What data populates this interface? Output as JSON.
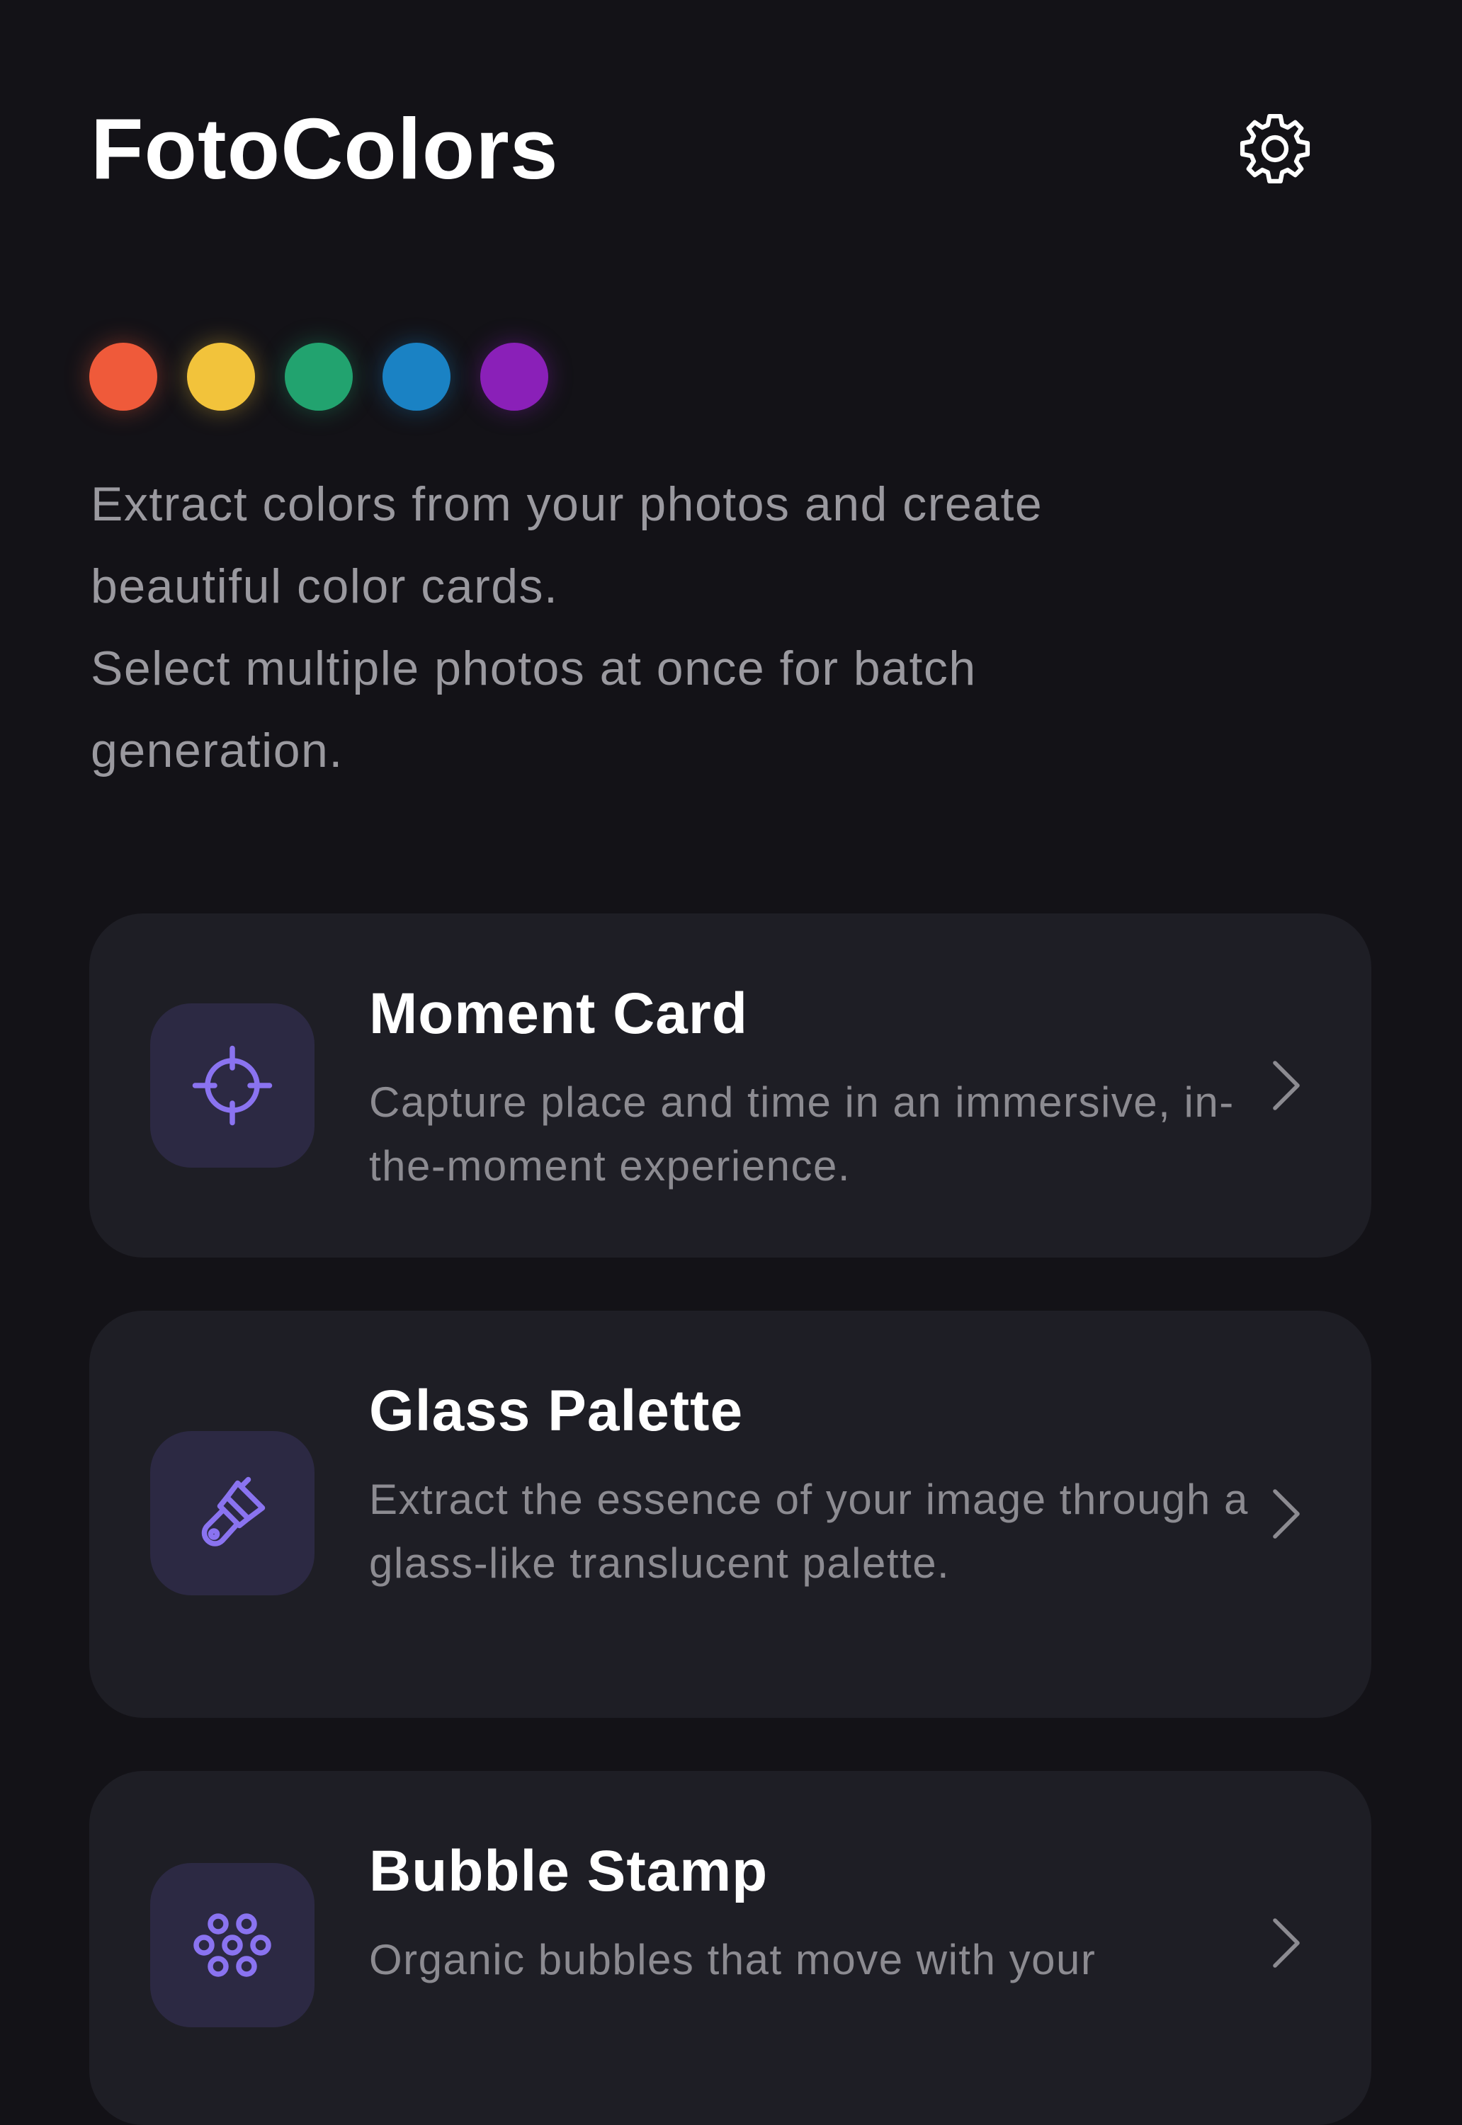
{
  "app": {
    "title": "FotoColors",
    "settings_icon": "gear-icon"
  },
  "color_dots": [
    {
      "color": "#ef5a3a"
    },
    {
      "color": "#f2c33b"
    },
    {
      "color": "#22a36f"
    },
    {
      "color": "#1a82c4"
    },
    {
      "color": "#8a20b8"
    }
  ],
  "intro": {
    "line1": "Extract colors from your photos and create beautiful color cards.",
    "line2": "Select multiple photos at once for batch generation."
  },
  "cards": [
    {
      "title": "Moment Card",
      "description": "Capture place and time in an immersive, in-the-moment experience.",
      "icon": "crosshair-icon"
    },
    {
      "title": "Glass Palette",
      "description": "Extract the essence of your image through a glass-like translucent palette.",
      "icon": "paintbrush-icon"
    },
    {
      "title": "Bubble Stamp",
      "description": "Organic bubbles that move with your",
      "icon": "bubbles-icon"
    }
  ],
  "colors": {
    "background": "#131217",
    "card": "#1e1e25",
    "icon_tile": "#2c2943",
    "accent": "#8a73f0"
  }
}
